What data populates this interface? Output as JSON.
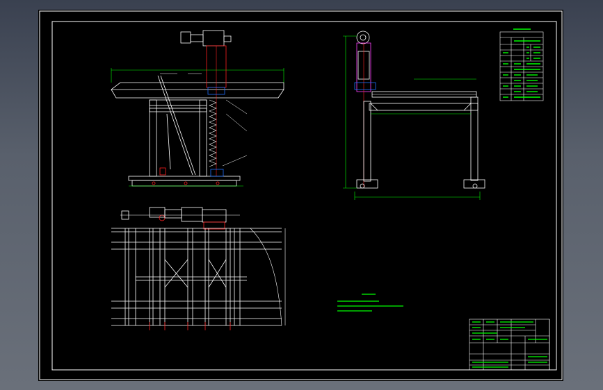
{
  "drawing": {
    "background_color": "#000000",
    "line_color": "#ffffff",
    "dimension_color": "#00ff00",
    "accent_color": "#ff2020",
    "detail_color": "#ff40ff",
    "highlight_color": "#2070ff"
  },
  "parameter_table": {
    "title": "",
    "rows": []
  },
  "technical_requirements": {
    "title": "",
    "items": []
  },
  "title_block": {
    "drawing_name": "",
    "drawing_number": ""
  }
}
